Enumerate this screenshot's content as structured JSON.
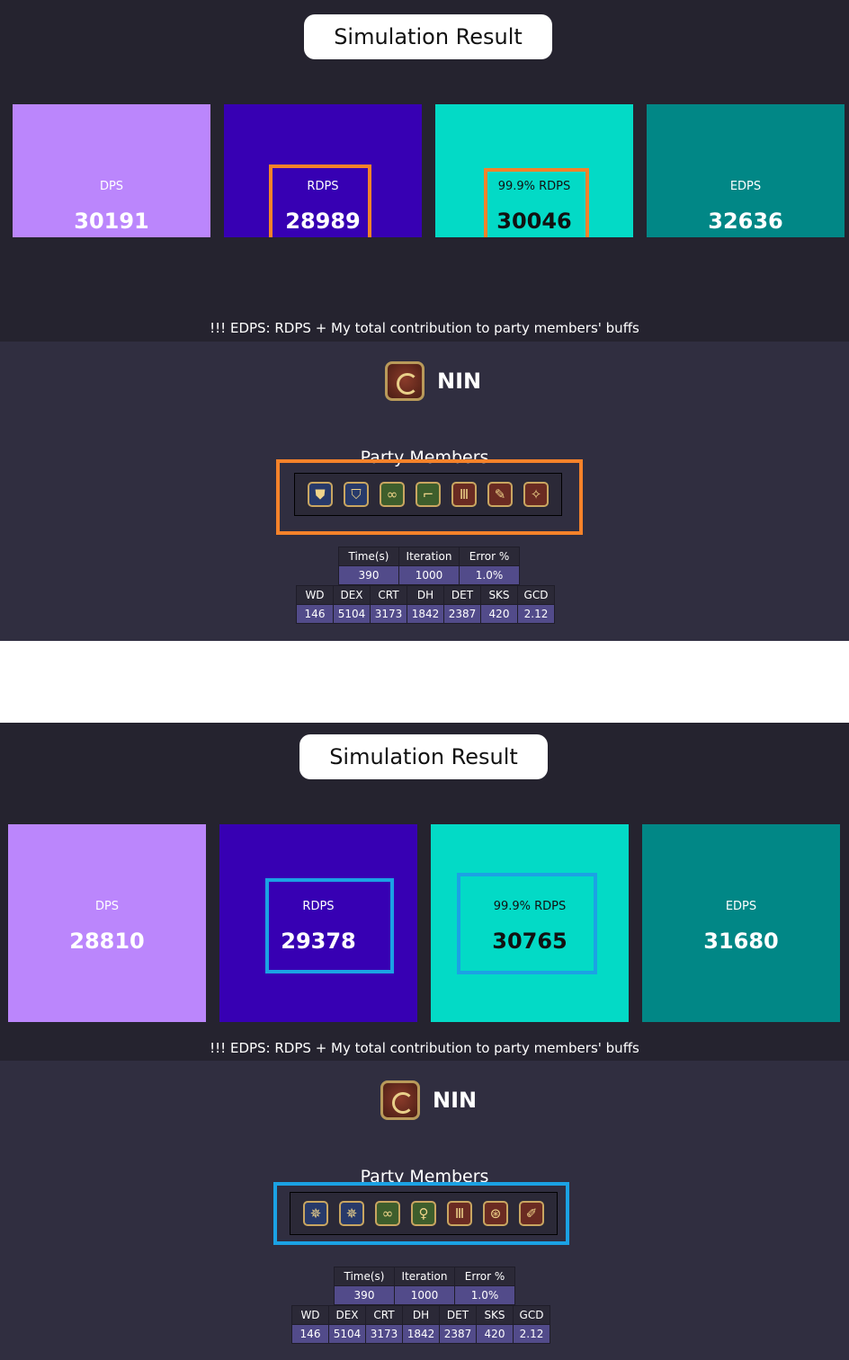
{
  "results": [
    {
      "title": "Simulation Result",
      "metrics": [
        {
          "label": "DPS",
          "value": "30191"
        },
        {
          "label": "RDPS",
          "value": "28989"
        },
        {
          "label": "99.9% RDPS",
          "value": "30046"
        },
        {
          "label": "EDPS",
          "value": "32636"
        }
      ],
      "note": "!!! EDPS: RDPS + My total contribution to party members' buffs",
      "job": "NIN",
      "party_title": "Party Members",
      "party_icons": [
        "paladin-icon",
        "scholar-icon",
        "sage-icon",
        "astrologian-icon",
        "machinist-icon",
        "ninja-icon",
        "red-mage-icon"
      ],
      "sim_headers": [
        "Time(s)",
        "Iteration",
        "Error %"
      ],
      "sim_values": [
        "390",
        "1000",
        "1.0%"
      ],
      "stat_headers": [
        "WD",
        "DEX",
        "CRT",
        "DH",
        "DET",
        "SKS",
        "GCD"
      ],
      "stat_values": [
        "146",
        "5104",
        "3173",
        "1842",
        "2387",
        "420",
        "2.12"
      ]
    },
    {
      "title": "Simulation Result",
      "metrics": [
        {
          "label": "DPS",
          "value": "28810"
        },
        {
          "label": "RDPS",
          "value": "29378"
        },
        {
          "label": "99.9% RDPS",
          "value": "30765"
        },
        {
          "label": "EDPS",
          "value": "31680"
        }
      ],
      "note": "!!! EDPS: RDPS + My total contribution to party members' buffs",
      "job": "NIN",
      "party_title": "Party Members",
      "party_icons": [
        "dark-knight-icon",
        "gunbreaker-icon",
        "sage-icon",
        "white-mage-icon",
        "machinist-icon",
        "reaper-icon",
        "red-mage-icon"
      ],
      "sim_headers": [
        "Time(s)",
        "Iteration",
        "Error %"
      ],
      "sim_values": [
        "390",
        "1000",
        "1.0%"
      ],
      "stat_headers": [
        "WD",
        "DEX",
        "CRT",
        "DH",
        "DET",
        "SKS",
        "GCD"
      ],
      "stat_values": [
        "146",
        "5104",
        "3173",
        "1842",
        "2387",
        "420",
        "2.12"
      ]
    }
  ],
  "colors": {
    "dps": "#bb86fc",
    "rdps": "#3700b3",
    "rdps999": "#03dac6",
    "edps": "#018786",
    "highlight_1": "#f5822a",
    "highlight_2": "#1ba2e4"
  }
}
